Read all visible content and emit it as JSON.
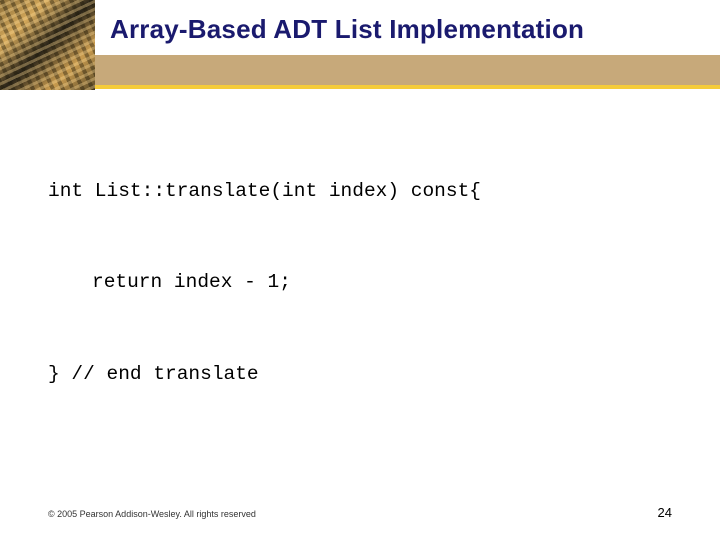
{
  "title": "Array-Based ADT List Implementation",
  "code": {
    "line1": "int List::translate(int index) const{",
    "line2": "return index - 1;",
    "line3": "} // end translate"
  },
  "footer": {
    "copyright": "© 2005 Pearson Addison-Wesley. All rights reserved",
    "page": "24"
  }
}
